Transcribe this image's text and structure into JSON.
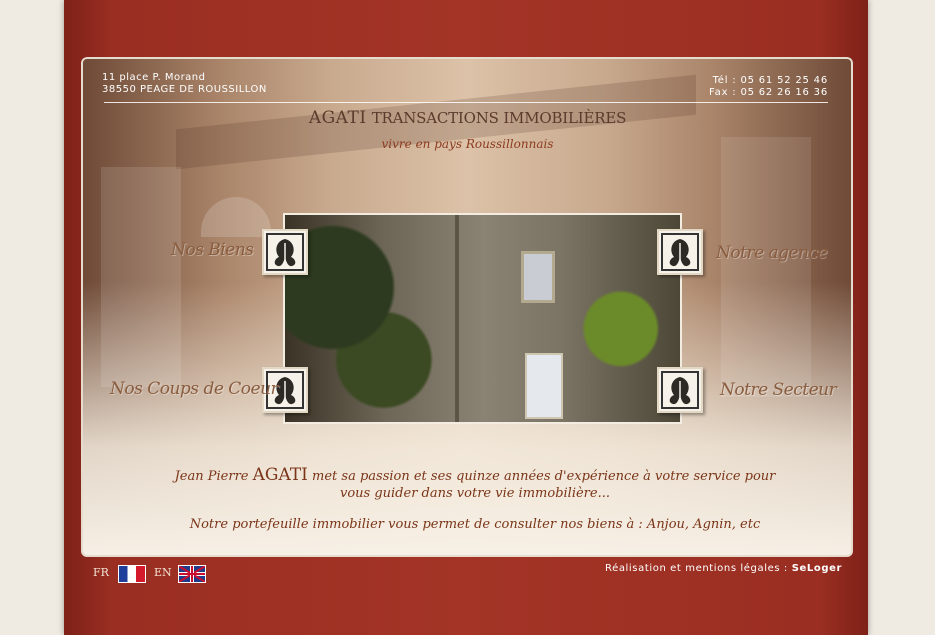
{
  "header": {
    "address_line1": "11 place P. Morand",
    "address_line2": "38550 PEAGE DE ROUSSILLON",
    "tel": "Tél : 05 61 52 25 46",
    "fax": "Fax : 05 62 26 16 36"
  },
  "brand": {
    "name": "AGATI",
    "rest": "TRANSACTIONS IMMOBILIÈRES",
    "tagline": "vivre en pays Roussillonnais"
  },
  "nav": {
    "biens": "Nos Biens",
    "agence": "Notre agence",
    "coups": "Nos Coups de Coeur",
    "secteur": "Notre Secteur"
  },
  "intro": {
    "pre": "Jean Pierre",
    "name": "AGATI",
    "post": "met sa passion et ses quinze années d'expérience à votre service pour",
    "line2": "vous guider dans votre vie immobilière...",
    "portfolio": "Notre portefeuille immobilier vous permet de consulter nos biens à : Anjou, Agnin, etc"
  },
  "lang": {
    "fr": "FR",
    "en": "EN"
  },
  "footer": {
    "credits_label": "Réalisation et mentions légales :",
    "credits_link": "SeLoger"
  },
  "colors": {
    "frame": "#a33426",
    "text_brown": "#7a3518",
    "nav_brown": "#8a5c3e"
  },
  "icons": [
    "leaf-ornament-icon",
    "flag-fr-icon",
    "flag-uk-icon"
  ]
}
